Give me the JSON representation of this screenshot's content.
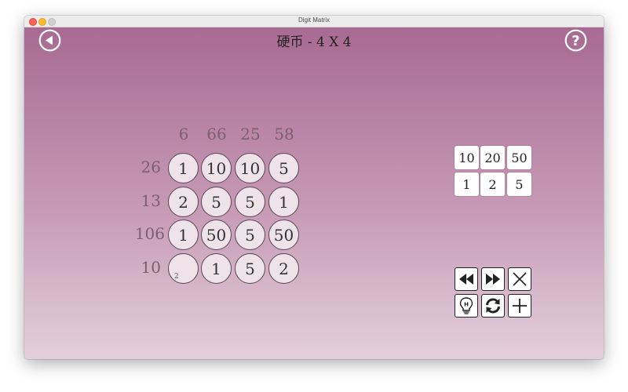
{
  "window": {
    "title": "Digit Matrix"
  },
  "header": {
    "title": "硬币 - 4 X 4"
  },
  "icons": {
    "back": "back-arrow-icon",
    "help": "question-mark-icon",
    "rewind": "rewind-icon",
    "fast_forward": "fast-forward-icon",
    "clear": "close-x-icon",
    "hint": "lightbulb-hint-icon",
    "restart": "refresh-icon",
    "add": "plus-icon"
  },
  "colors": {
    "background_top": "#a86a92",
    "background_bottom": "#e3cfdb",
    "clue_text": "#7a6170",
    "cell_fill": "#efe3ea"
  },
  "puzzle": {
    "column_clues": [
      "6",
      "66",
      "25",
      "58"
    ],
    "rows": [
      {
        "clue": "26",
        "cells": [
          {
            "value": "1",
            "note": ""
          },
          {
            "value": "10",
            "note": ""
          },
          {
            "value": "10",
            "note": ""
          },
          {
            "value": "5",
            "note": ""
          }
        ]
      },
      {
        "clue": "13",
        "cells": [
          {
            "value": "2",
            "note": ""
          },
          {
            "value": "5",
            "note": ""
          },
          {
            "value": "5",
            "note": ""
          },
          {
            "value": "1",
            "note": ""
          }
        ]
      },
      {
        "clue": "106",
        "cells": [
          {
            "value": "1",
            "note": ""
          },
          {
            "value": "50",
            "note": ""
          },
          {
            "value": "5",
            "note": ""
          },
          {
            "value": "50",
            "note": ""
          }
        ]
      },
      {
        "clue": "10",
        "cells": [
          {
            "value": "",
            "note": "2"
          },
          {
            "value": "1",
            "note": ""
          },
          {
            "value": "5",
            "note": ""
          },
          {
            "value": "2",
            "note": ""
          }
        ]
      }
    ]
  },
  "palette": {
    "values": [
      "10",
      "20",
      "50",
      "1",
      "2",
      "5"
    ]
  }
}
